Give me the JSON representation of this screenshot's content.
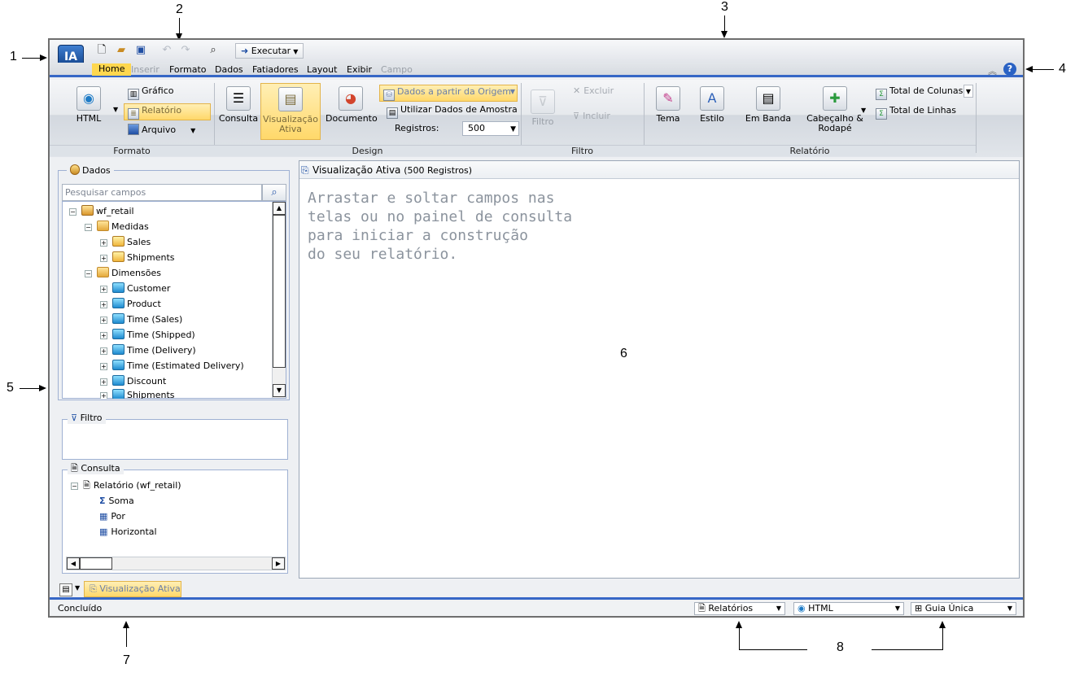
{
  "callouts": {
    "c1": "1",
    "c2": "2",
    "c3": "3",
    "c4": "4",
    "c5": "5",
    "c6": "6",
    "c7": "7",
    "c8": "8"
  },
  "logo": {
    "text": "IA"
  },
  "quick_access": {
    "execute_label": "Executar"
  },
  "menu": {
    "home": "Home",
    "insert": "Inserir",
    "format": "Formato",
    "data": "Dados",
    "slicers": "Fatiadores",
    "layout": "Layout",
    "view": "Exibir",
    "field": "Campo"
  },
  "ribbon": {
    "html": "HTML",
    "chart": "Gráfico",
    "report": "Relatório",
    "file": "Arquivo",
    "query": "Consulta",
    "live_view_l1": "Visualização",
    "live_view_l2": "Ativa",
    "document": "Documento",
    "data_from_source": "Dados a partir da Origem",
    "use_sample": "Utilizar Dados de Amostra",
    "records_label": "Registros:",
    "records_value": "500",
    "filter": "Filtro",
    "exclude": "Excluir",
    "include": "Incluir",
    "theme": "Tema",
    "style": "Estilo",
    "banded": "Em Banda",
    "header_footer_l1": "Cabeçalho &",
    "header_footer_l2": "Rodapé",
    "col_totals": "Total de Colunas",
    "row_totals": "Total de Linhas",
    "groups": {
      "format": "Formato",
      "design": "Design",
      "filter": "Filtro",
      "report": "Relatório"
    }
  },
  "data_panel": {
    "title": "Dados",
    "search_placeholder": "Pesquisar campos",
    "tree": {
      "root": "wf_retail",
      "measures": "Medidas",
      "sales": "Sales",
      "shipments_m": "Shipments",
      "dimensions": "Dimensões",
      "customer": "Customer",
      "product": "Product",
      "time_sales": "Time (Sales)",
      "time_shipped": "Time (Shipped)",
      "time_delivery": "Time (Delivery)",
      "time_est": "Time (Estimated Delivery)",
      "discount": "Discount",
      "shipments_d": "Shipments"
    }
  },
  "filter_panel": {
    "title": "Filtro"
  },
  "query_panel": {
    "title": "Consulta",
    "report": "Relatório (wf_retail)",
    "sum": "Soma",
    "by": "Por",
    "across": "Horizontal"
  },
  "canvas": {
    "title": "Visualização Ativa",
    "records": "(500 Registros)",
    "hint": "Arrastar e soltar campos nas\ntelas ou no painel de consulta\npara iniciar a construção\ndo seu relatório."
  },
  "tab": {
    "live_view": "Visualização Ativa"
  },
  "status": {
    "text": "Concluído",
    "reports": "Relatórios",
    "output": "HTML",
    "tab_mode": "Guia Única"
  }
}
